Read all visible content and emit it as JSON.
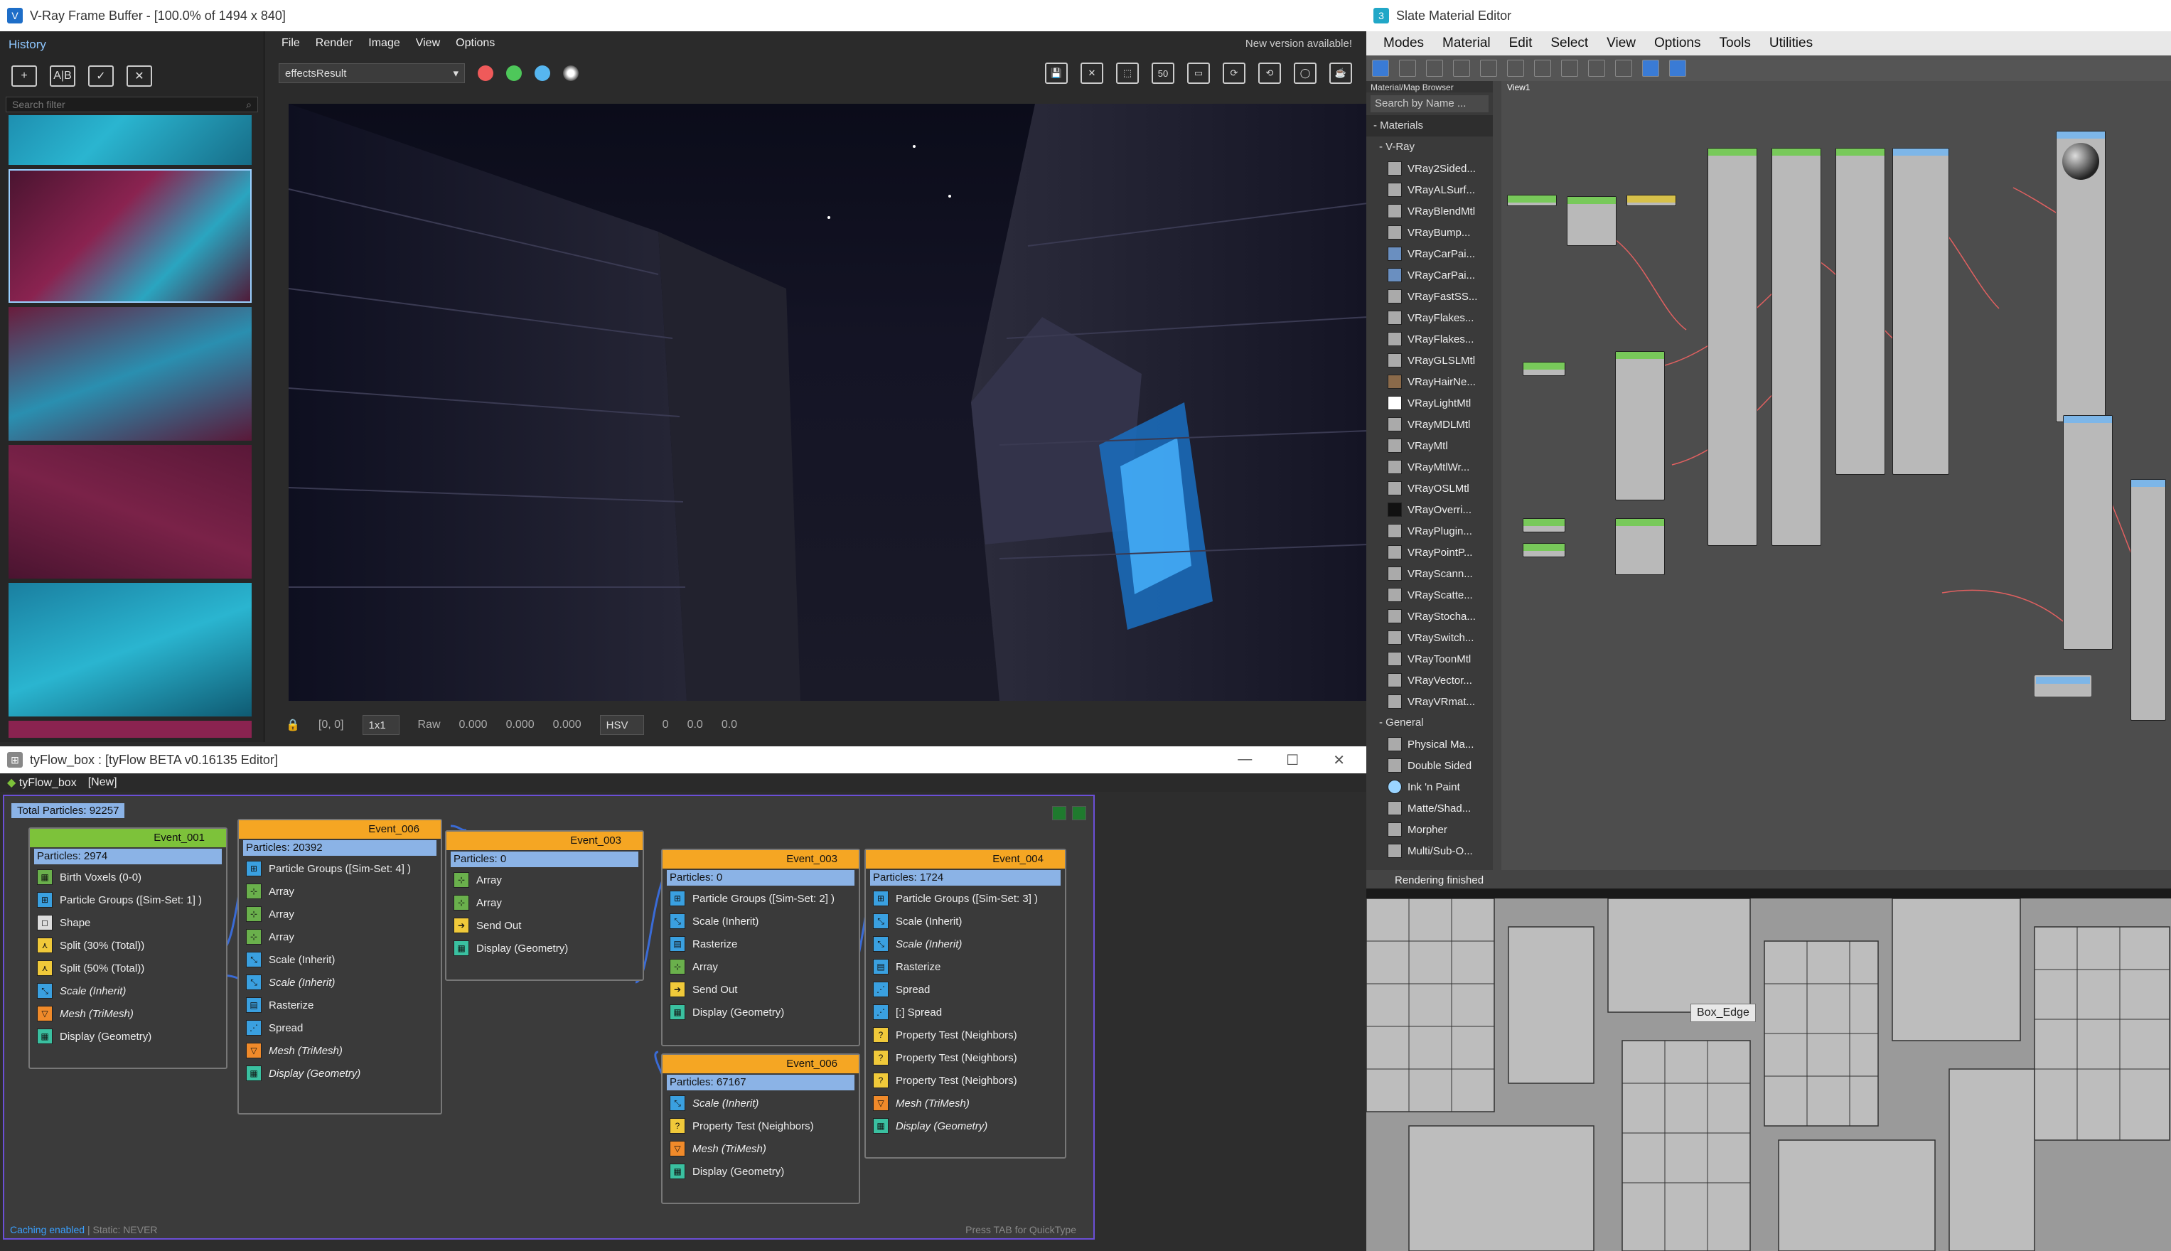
{
  "vfb": {
    "title": "V-Ray Frame Buffer - [100.0% of 1494 x 840]",
    "history_label": "History",
    "search_placeholder": "Search filter",
    "menu": [
      "File",
      "Render",
      "Image",
      "View",
      "Options"
    ],
    "notice": "New version available!",
    "channel": "effectsResult",
    "status": {
      "coords": "[0, 0]",
      "zoom": "1x1",
      "mode": "Raw",
      "r": "0.000",
      "g": "0.000",
      "b": "0.000",
      "space": "HSV",
      "h": "0",
      "s": "0.0",
      "v": "0.0"
    }
  },
  "slate": {
    "title": "Slate Material Editor",
    "menu": [
      "Modes",
      "Material",
      "Edit",
      "Select",
      "View",
      "Options",
      "Tools",
      "Utilities"
    ],
    "browser_header": "Material/Map Browser",
    "search_placeholder": "Search by Name ...",
    "view_tab": "View1",
    "cat_materials": "- Materials",
    "cat_vray": "- V-Ray",
    "vray_items": [
      "VRay2Sided...",
      "VRayALSurf...",
      "VRayBlendMtl",
      "VRayBump...",
      "VRayCarPai...",
      "VRayCarPai...",
      "VRayFastSS...",
      "VRayFlakes...",
      "VRayFlakes...",
      "VRayGLSLMtl",
      "VRayHairNe...",
      "VRayLightMtl",
      "VRayMDLMtl",
      "VRayMtl",
      "VRayMtlWr...",
      "VRayOSLMtl",
      "VRayOverri...",
      "VRayPlugin...",
      "VRayPointP...",
      "VRayScann...",
      "VRayScatte...",
      "VRayStocha...",
      "VRaySwitch...",
      "VRayToonMtl",
      "VRayVector...",
      "VRayVRmat..."
    ],
    "cat_general": "- General",
    "general_items": [
      "Physical Ma...",
      "Double Sided",
      "Ink 'n Paint",
      "Matte/Shad...",
      "Morpher",
      "Multi/Sub-O..."
    ],
    "status": "Rendering finished"
  },
  "viewport": {
    "label": "Box_Edge"
  },
  "tyflow": {
    "title": "tyFlow_box : [tyFlow BETA v0.16135 Editor]",
    "tab_name": "tyFlow_box",
    "tab_new": "[New]",
    "total": "Total Particles: 92257",
    "footer_left": "Caching enabled",
    "footer_sep": " | Static: NEVER",
    "footer_right": "Press TAB for QuickType",
    "events": [
      {
        "name": "Event_001",
        "count": "Particles: 2974",
        "ops": [
          "Birth Voxels (0-0)",
          "Particle Groups ([Sim-Set: 1] )",
          "Shape",
          "Split (30% (Total))",
          "Split (50% (Total))",
          "Scale (Inherit)",
          "Mesh (TriMesh)",
          "Display (Geometry)"
        ]
      },
      {
        "name": "Event_006",
        "count": "Particles: 20392",
        "ops": [
          "Particle Groups ([Sim-Set: 4] )",
          "Array",
          "Array",
          "Array",
          "Scale (Inherit)",
          "Scale (Inherit)",
          "Rasterize",
          "Spread",
          "Mesh (TriMesh)",
          "Display (Geometry)"
        ]
      },
      {
        "name": "Event_003",
        "count": "Particles: 0",
        "ops": [
          "Array",
          "Array",
          "Send Out",
          "Display (Geometry)"
        ]
      },
      {
        "name": "Event_003",
        "count": "Particles: 0",
        "ops": [
          "Particle Groups ([Sim-Set: 2] )",
          "Scale (Inherit)",
          "Rasterize",
          "Array",
          "Send Out",
          "Display (Geometry)"
        ]
      },
      {
        "name": "Event_004",
        "count": "Particles: 1724",
        "ops": [
          "Particle Groups ([Sim-Set: 3] )",
          "Scale (Inherit)",
          "Scale (Inherit)",
          "Rasterize",
          "Spread",
          "[:] Spread",
          "Property Test (Neighbors)",
          "Property Test (Neighbors)",
          "Property Test (Neighbors)",
          "Mesh (TriMesh)",
          "Display (Geometry)"
        ]
      },
      {
        "name": "Event_006",
        "count": "Particles: 67167",
        "ops": [
          "Scale (Inherit)",
          "Property Test (Neighbors)",
          "Mesh (TriMesh)",
          "Display (Geometry)"
        ]
      }
    ]
  },
  "colors": {
    "event_green": "#7dc23a",
    "event_orange": "#f5a623",
    "count_blue": "#8bb3e6",
    "accent": "#6b4fd6"
  }
}
